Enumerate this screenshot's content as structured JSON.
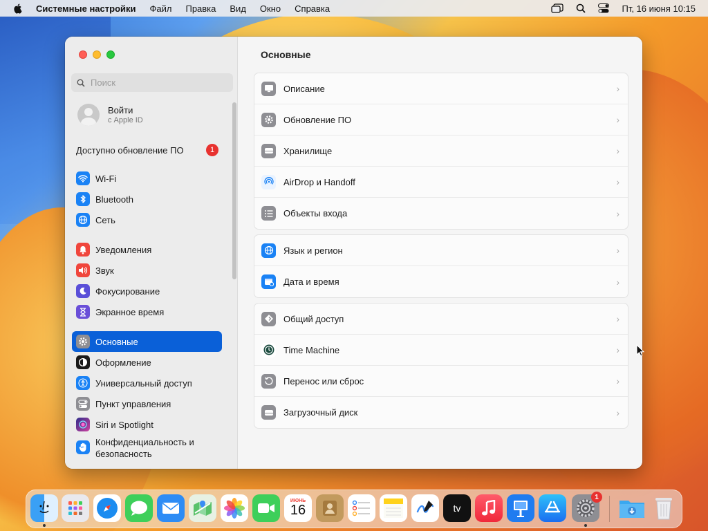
{
  "menubar": {
    "app_name": "Системные настройки",
    "menus": [
      "Файл",
      "Правка",
      "Вид",
      "Окно",
      "Справка"
    ],
    "clock": "Пт, 16 июня  10:15"
  },
  "sidebar": {
    "search_placeholder": "Поиск",
    "account": {
      "name": "Войти",
      "subtitle": "с Apple ID"
    },
    "update": {
      "label": "Доступно обновление ПО",
      "count": "1"
    },
    "items": [
      {
        "label": "Wi-Fi",
        "icon": "wifi-icon",
        "color": "#1a82f5"
      },
      {
        "label": "Bluetooth",
        "icon": "bluetooth-icon",
        "color": "#1a82f5"
      },
      {
        "label": "Сеть",
        "icon": "globe-icon",
        "color": "#1a82f5"
      },
      {
        "label": "Уведомления",
        "icon": "bell-icon",
        "color": "#f0463c"
      },
      {
        "label": "Звук",
        "icon": "speaker-icon",
        "color": "#f0463c"
      },
      {
        "label": "Фокусирование",
        "icon": "moon-icon",
        "color": "#5a4fd8"
      },
      {
        "label": "Экранное время",
        "icon": "hourglass-icon",
        "color": "#6a4fd8"
      },
      {
        "label": "Основные",
        "icon": "gear-icon",
        "color": "#8e8e93"
      },
      {
        "label": "Оформление",
        "icon": "appearance-icon",
        "color": "#1a1a1a"
      },
      {
        "label": "Универсальный доступ",
        "icon": "accessibility-icon",
        "color": "#1a82f5"
      },
      {
        "label": "Пункт управления",
        "icon": "control-center-icon",
        "color": "#8e8e93"
      },
      {
        "label": "Siri и Spotlight",
        "icon": "siri-icon",
        "color": "#a040d0"
      },
      {
        "label": "Конфиденциальность и безопасность",
        "icon": "hand-icon",
        "color": "#1a82f5"
      }
    ]
  },
  "content": {
    "title": "Основные",
    "groups": [
      [
        {
          "label": "Описание",
          "icon": "display-icon",
          "color": "#8e8e93"
        },
        {
          "label": "Обновление ПО",
          "icon": "gear-icon",
          "color": "#8e8e93"
        },
        {
          "label": "Хранилище",
          "icon": "storage-icon",
          "color": "#8e8e93"
        },
        {
          "label": "AirDrop и Handoff",
          "icon": "airdrop-icon",
          "color": "#1a82f5"
        },
        {
          "label": "Объекты входа",
          "icon": "list-icon",
          "color": "#8e8e93"
        }
      ],
      [
        {
          "label": "Язык и регион",
          "icon": "globe-icon",
          "color": "#1a82f5"
        },
        {
          "label": "Дата и время",
          "icon": "calendar-clock-icon",
          "color": "#1a82f5"
        }
      ],
      [
        {
          "label": "Общий доступ",
          "icon": "sharing-icon",
          "color": "#8e8e93"
        },
        {
          "label": "Time Machine",
          "icon": "time-machine-icon",
          "color": "#1e6b5a"
        },
        {
          "label": "Перенос или сброс",
          "icon": "reset-icon",
          "color": "#8e8e93"
        },
        {
          "label": "Загрузочный диск",
          "icon": "disk-icon",
          "color": "#8e8e93"
        }
      ]
    ]
  },
  "dock": {
    "calendar_month": "ИЮНЬ",
    "calendar_day": "16",
    "tv_label": "tv",
    "settings_badge": "1"
  }
}
